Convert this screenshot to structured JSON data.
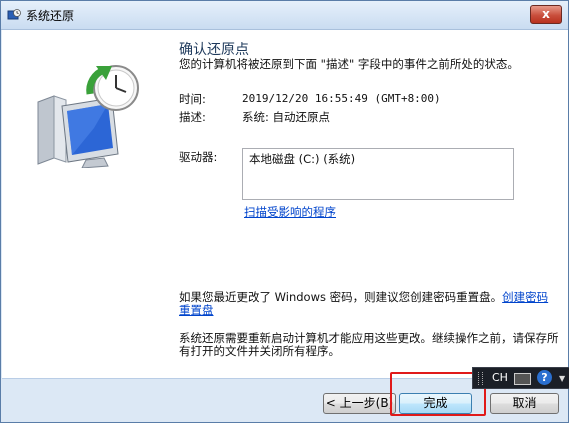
{
  "window": {
    "title": "系统还原",
    "close_label": "x"
  },
  "content": {
    "heading": "确认还原点",
    "description": "您的计算机将被还原到下面 \"描述\" 字段中的事件之前所处的状态。",
    "time_label": "时间:",
    "time_value": "2019/12/20 16:55:49 (GMT+8:00)",
    "desc_label": "描述:",
    "desc_value": "系统: 自动还原点",
    "drives_label": "驱动器:",
    "drive_item": "本地磁盘 (C:) (系统)",
    "scan_link": "扫描受影响的程序",
    "password_note": "如果您最近更改了 Windows 密码，则建议您创建密码重置盘。",
    "password_link": "创建密码重置盘",
    "restart_note": "系统还原需要重新启动计算机才能应用这些更改。继续操作之前，请保存所有打开的文件并关闭所有程序。"
  },
  "buttons": {
    "back": "< 上一步(B)",
    "finish": "完成",
    "cancel": "取消"
  },
  "langbar": {
    "language": "CH",
    "help": "?"
  },
  "colors": {
    "highlight": "#e01a1a",
    "link": "#0044cc",
    "heading": "#1e395b"
  }
}
